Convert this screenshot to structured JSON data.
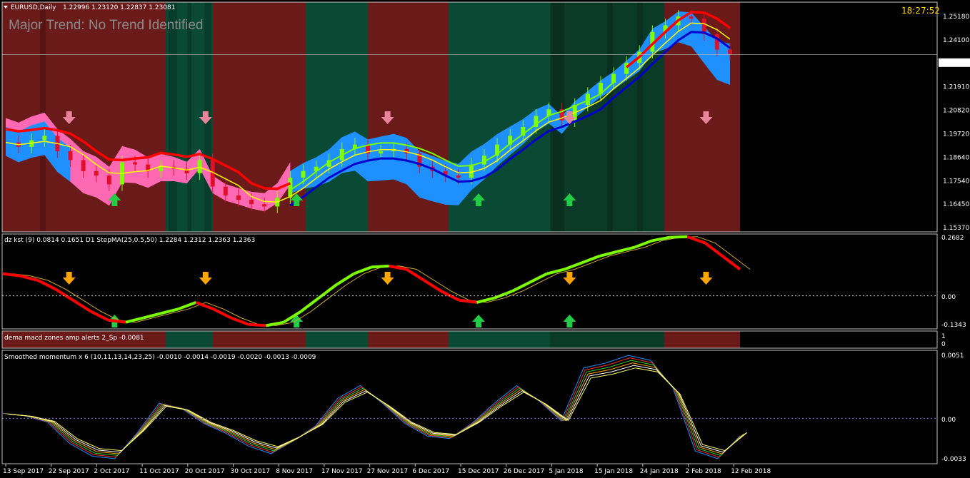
{
  "header": {
    "symbol": "EURUSD,Daily",
    "ohlc": "1.22996 1.23120 1.22837 1.23081",
    "trend_text": "Major Trend: No Trend Identified",
    "clock": "18:27:52"
  },
  "colors": {
    "bull_zone": "#0a4a34",
    "bull_zone_dark": "#0c3a28",
    "bear_zone": "#6a1a18",
    "bull_candle": "#7fff00",
    "bear_candle": "#e0102a",
    "cloud_blue": "#1e90ff",
    "cloud_pink": "#ff69b4",
    "ma_red": "#ff0000",
    "ma_blue": "#0000cc",
    "ma_green": "#7cfc00",
    "ma_yellow": "#ffff00",
    "arrow_up": "#22cc44",
    "arrow_down_pink": "#e8859a",
    "arrow_down_orange": "#ffa500"
  },
  "chart_data": [
    {
      "type": "line",
      "pane": "price",
      "ylabels": [
        "1.25180",
        "1.24100",
        "1.23081",
        "1.21910",
        "1.20820",
        "1.19720",
        "1.18640",
        "1.17540",
        "1.16450",
        "1.15370"
      ],
      "last_price": "1.23081",
      "x_dates": [
        "13 Sep 2017",
        "22 Sep 2017",
        "2 Oct 2017",
        "11 Oct 2017",
        "20 Oct 2017",
        "30 Oct 2017",
        "8 Nov 2017",
        "17 Nov 2017",
        "27 Nov 2017",
        "6 Dec 2017",
        "15 Dec 2017",
        "26 Dec 2017",
        "5 Jan 2018",
        "15 Jan 2018",
        "24 Jan 2018",
        "2 Feb 2018",
        "12 Feb 2018"
      ],
      "close_trace": [
        1.191,
        1.189,
        1.192,
        1.194,
        1.187,
        1.183,
        1.178,
        1.176,
        1.172,
        1.182,
        1.181,
        1.178,
        1.18,
        1.179,
        1.177,
        1.183,
        1.171,
        1.167,
        1.165,
        1.163,
        1.162,
        1.166,
        1.175,
        1.178,
        1.18,
        1.183,
        1.188,
        1.19,
        1.186,
        1.187,
        1.188,
        1.186,
        1.18,
        1.178,
        1.176,
        1.175,
        1.181,
        1.185,
        1.19,
        1.194,
        1.198,
        1.203,
        1.206,
        1.201,
        1.208,
        1.213,
        1.218,
        1.222,
        1.227,
        1.232,
        1.241,
        1.244,
        1.248,
        1.247,
        1.24,
        1.233,
        1.231
      ],
      "down_arrows": [
        "22 Sep 2017",
        "20 Oct 2017",
        "27 Nov 2017",
        "5 Jan 2018",
        "2 Feb 2018"
      ],
      "up_arrows": [
        "2 Oct 2017",
        "8 Nov 2017",
        "15 Dec 2017",
        "5 Jan 2018"
      ]
    },
    {
      "type": "line",
      "pane": "kst",
      "title": "dz kst (9) 0.0814 0.1651  D1 StepMA(25,0.5,50) 1.2284 1.2312 1.2363 1.2363",
      "ylabels": [
        "0.2682",
        "0.00",
        "-0.1343"
      ],
      "values": [
        0.1,
        0.09,
        0.07,
        0.03,
        -0.02,
        -0.07,
        -0.11,
        -0.12,
        -0.1,
        -0.08,
        -0.06,
        -0.03,
        -0.06,
        -0.1,
        -0.13,
        -0.135,
        -0.12,
        -0.07,
        -0.01,
        0.05,
        0.1,
        0.13,
        0.135,
        0.12,
        0.07,
        0.02,
        -0.02,
        -0.03,
        -0.01,
        0.02,
        0.06,
        0.1,
        0.12,
        0.15,
        0.18,
        0.2,
        0.22,
        0.25,
        0.265,
        0.268,
        0.24,
        0.18,
        0.12
      ],
      "up_arrows": [
        "2 Oct 2017",
        "8 Nov 2017",
        "15 Dec 2017",
        "5 Jan 2018"
      ],
      "down_arrows": [
        "22 Sep 2017",
        "20 Oct 2017",
        "27 Nov 2017",
        "5 Jan 2018",
        "2 Feb 2018"
      ]
    },
    {
      "type": "heatmap",
      "pane": "macd_zones",
      "title": "dema macd zones amp alerts 2_Sp -0.0081",
      "ylabels": [
        "1",
        "0"
      ]
    },
    {
      "type": "line",
      "pane": "momentum",
      "title": "Smoothed momentum x 6 (10,11,13,14,23,25) -0.0010 -0.0014 -0.0019 -0.0020 -0.0013 -0.0009",
      "ylabels": [
        "0.0051",
        "0.00",
        "-0.0033"
      ],
      "values": [
        0.0004,
        0.0002,
        -0.0003,
        -0.002,
        -0.003,
        -0.0032,
        -0.0012,
        0.0012,
        0.0008,
        -0.0004,
        -0.0012,
        -0.0022,
        -0.0028,
        -0.0018,
        -0.0006,
        0.0016,
        0.0026,
        0.0012,
        -0.0004,
        -0.0014,
        -0.0016,
        -0.0004,
        0.0012,
        0.0026,
        0.0014,
        -0.0002,
        0.004,
        0.0044,
        0.005,
        0.0046,
        0.0024,
        -0.0026,
        -0.0032,
        -0.0014
      ]
    }
  ]
}
